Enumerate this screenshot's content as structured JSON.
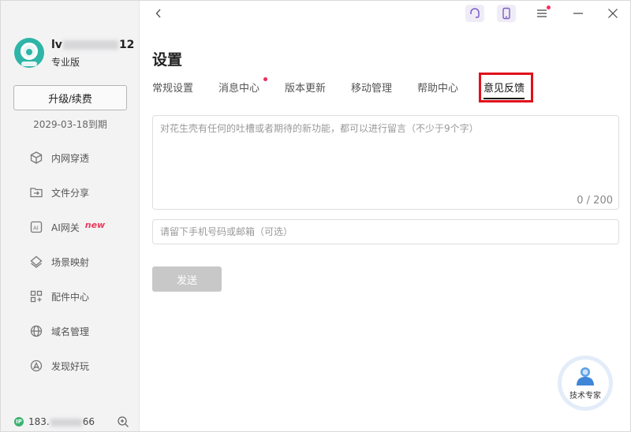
{
  "window": {
    "back_icon": "chevron-left-icon",
    "controls": {
      "support_icon": "headset-icon",
      "mobile_icon": "mobile-phone-icon",
      "menu_icon": "hamburger-menu-icon",
      "minimize_icon": "minimize-icon",
      "close_icon": "close-icon"
    }
  },
  "sidebar": {
    "user": {
      "name_prefix": "lv",
      "name_suffix": "12",
      "plan": "专业版"
    },
    "upgrade_label": "升级/续费",
    "expiry": "2029-03-18到期",
    "items": [
      {
        "label": "内网穿透",
        "icon": "cube-icon"
      },
      {
        "label": "文件分享",
        "icon": "folder-share-icon"
      },
      {
        "label": "AI网关",
        "icon": "ai-icon",
        "badge": "new"
      },
      {
        "label": "场景映射",
        "icon": "layers-icon"
      },
      {
        "label": "配件中心",
        "icon": "grid-plus-icon"
      },
      {
        "label": "域名管理",
        "icon": "globe-icon"
      },
      {
        "label": "发现好玩",
        "icon": "compass-icon"
      }
    ],
    "footer": {
      "ip_prefix": "183.",
      "ip_suffix": "66",
      "ip_icon": "IP"
    }
  },
  "settings": {
    "title": "设置",
    "tabs": [
      {
        "label": "常规设置"
      },
      {
        "label": "消息中心"
      },
      {
        "label": "版本更新"
      },
      {
        "label": "移动管理"
      },
      {
        "label": "帮助中心"
      },
      {
        "label": "意见反馈"
      }
    ],
    "feedback": {
      "placeholder": "对花生壳有任何的吐槽或者期待的新功能，都可以进行留言（不少于9个字）",
      "count": "0 / 200"
    },
    "contact": {
      "placeholder": "请留下手机号码或邮箱（可选）"
    },
    "send_label": "发送"
  },
  "expert": {
    "label": "技术专家"
  },
  "colors": {
    "accent": "#2fb5a7",
    "highlight": "#e0101a",
    "badge": "#f02d5b"
  }
}
